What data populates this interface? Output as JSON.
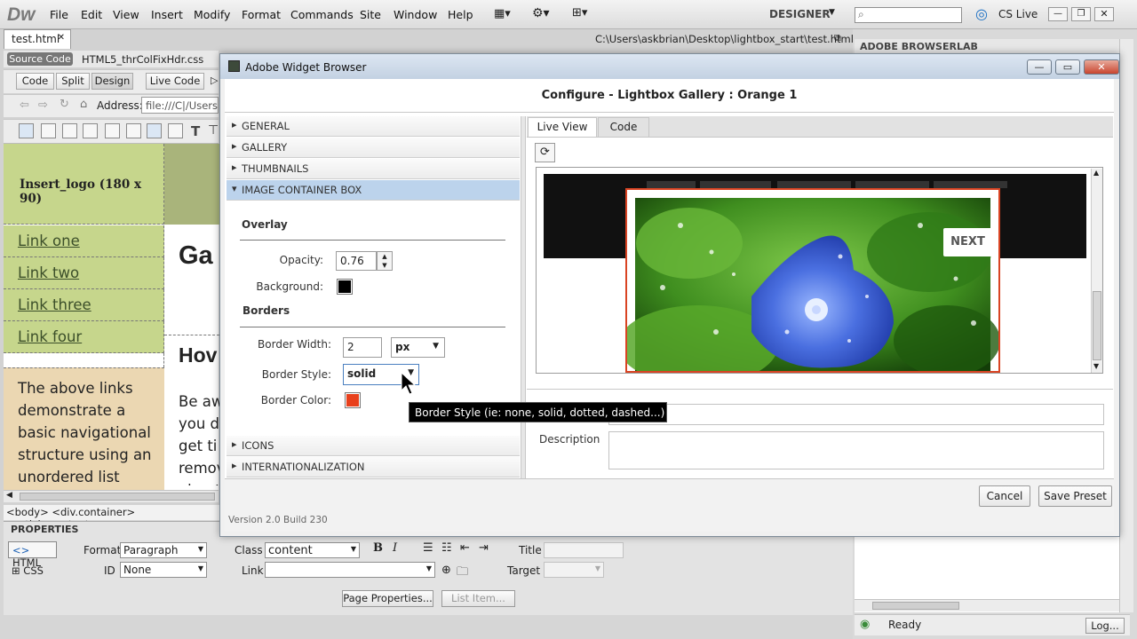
{
  "app": {
    "logo": "Dw"
  },
  "menu": [
    "File",
    "Edit",
    "View",
    "Insert",
    "Modify",
    "Format",
    "Commands",
    "Site",
    "Window",
    "Help"
  ],
  "workspace": "DESIGNER",
  "cs_live": "CS Live",
  "document": {
    "tab": "test.html",
    "path": "C:\\Users\\askbrian\\Desktop\\lightbox_start\\test.html",
    "source_code": "Source Code",
    "related_file": "HTML5_thrColFixHdr.css",
    "views": [
      "Code",
      "Split",
      "Design",
      "Live Code"
    ],
    "address_label": "Address:",
    "address_value": "file:///C|/Users/a"
  },
  "page": {
    "logo_placeholder": "Insert_logo (180 x 90)",
    "nav": [
      "Link one",
      "Link two",
      "Link three",
      "Link four"
    ],
    "sidebar_lines": [
      "The above links",
      "demonstrate a",
      "basic navigational",
      "structure using an",
      "unordered list"
    ],
    "heading": "Ga",
    "subheading": "Hov",
    "paragraph_lines": [
      "Be aw",
      "you d",
      "get ti",
      "remov",
      "about"
    ]
  },
  "tag_selector": "<body> <div.container> <article.content> <p>",
  "properties": {
    "title": "PROPERTIES",
    "html_btn": "HTML",
    "css_btn": "CSS",
    "format_label": "Format",
    "format_value": "Paragraph",
    "id_label": "ID",
    "id_value": "None",
    "class_label": "Class",
    "class_value": "content",
    "link_label": "Link",
    "title_label": "Title",
    "target_label": "Target",
    "page_properties": "Page Properties...",
    "list_item": "List Item..."
  },
  "right_panel": {
    "title": "ADOBE BROWSERLAB",
    "status": "Ready",
    "log_btn": "Log..."
  },
  "dialog": {
    "title": "Adobe Widget Browser",
    "configure_title": "Configure -  Lightbox Gallery  : Orange 1",
    "sections": [
      "GENERAL",
      "GALLERY",
      "THUMBNAILS",
      "IMAGE CONTAINER BOX",
      "ICONS",
      "INTERNATIONALIZATION"
    ],
    "overlay_heading": "Overlay",
    "opacity_label": "Opacity:",
    "opacity_value": "0.76",
    "background_label": "Background:",
    "background_color": "#000000",
    "borders_heading": "Borders",
    "border_width_label": "Border Width:",
    "border_width_value": "2",
    "border_unit": "px",
    "border_style_label": "Border Style:",
    "border_style_value": "solid",
    "border_color_label": "Border Color:",
    "border_color": "#e8401c",
    "tooltip": "Border Style (ie: none, solid, dotted, dashed...)",
    "tabs": [
      "Live View",
      "Code"
    ],
    "next_label": "NEXT",
    "description_label": "Description",
    "cancel": "Cancel",
    "save_preset": "Save Preset",
    "version": "Version 2.0 Build 230"
  }
}
